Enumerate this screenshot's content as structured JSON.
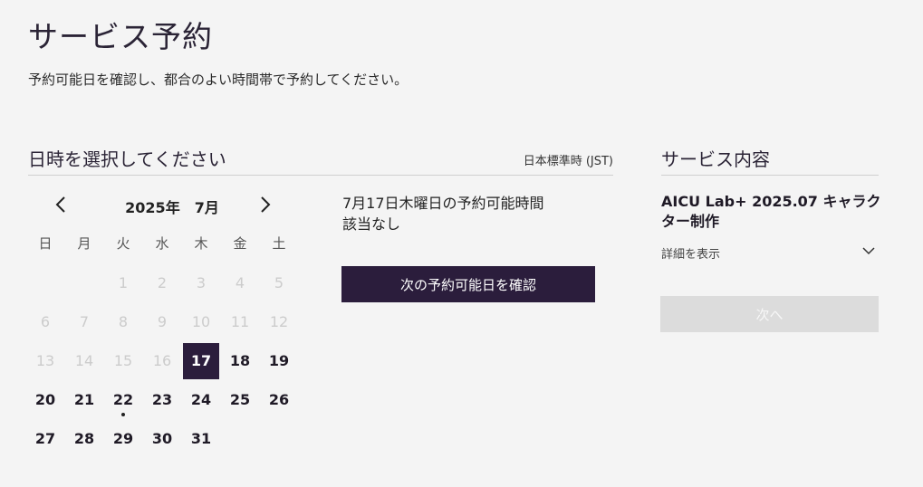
{
  "header": {
    "title": "サービス予約",
    "subtitle": "予約可能日を確認し、都合のよい時間帯で予約してください。"
  },
  "datetime": {
    "heading": "日時を選択してください",
    "timezone": "日本標準時 (JST)"
  },
  "calendar": {
    "month_label": "2025年　7月",
    "weekdays": [
      "日",
      "月",
      "火",
      "水",
      "木",
      "金",
      "土"
    ],
    "days": [
      {
        "label": "1",
        "state": "disabled"
      },
      {
        "label": "2",
        "state": "disabled"
      },
      {
        "label": "3",
        "state": "disabled"
      },
      {
        "label": "4",
        "state": "disabled"
      },
      {
        "label": "5",
        "state": "disabled"
      },
      {
        "label": "6",
        "state": "disabled"
      },
      {
        "label": "7",
        "state": "disabled"
      },
      {
        "label": "8",
        "state": "disabled"
      },
      {
        "label": "9",
        "state": "disabled"
      },
      {
        "label": "10",
        "state": "disabled"
      },
      {
        "label": "11",
        "state": "disabled"
      },
      {
        "label": "12",
        "state": "disabled"
      },
      {
        "label": "13",
        "state": "disabled"
      },
      {
        "label": "14",
        "state": "disabled"
      },
      {
        "label": "15",
        "state": "disabled"
      },
      {
        "label": "16",
        "state": "disabled"
      },
      {
        "label": "17",
        "state": "selected"
      },
      {
        "label": "18",
        "state": "enabled"
      },
      {
        "label": "19",
        "state": "enabled"
      },
      {
        "label": "20",
        "state": "enabled"
      },
      {
        "label": "21",
        "state": "enabled"
      },
      {
        "label": "22",
        "state": "today"
      },
      {
        "label": "23",
        "state": "enabled"
      },
      {
        "label": "24",
        "state": "enabled"
      },
      {
        "label": "25",
        "state": "enabled"
      },
      {
        "label": "26",
        "state": "enabled"
      },
      {
        "label": "27",
        "state": "enabled"
      },
      {
        "label": "28",
        "state": "enabled"
      },
      {
        "label": "29",
        "state": "enabled"
      },
      {
        "label": "30",
        "state": "enabled"
      },
      {
        "label": "31",
        "state": "enabled"
      }
    ]
  },
  "availability": {
    "title_line1": "7月17日木曜日の予約可能時間",
    "title_line2": "該当なし",
    "next_button": "次の予約可能日を確認"
  },
  "service": {
    "heading": "サービス内容",
    "name": "AICU Lab+ 2025.07 キャラクター制作",
    "detail_toggle": "詳細を表示",
    "next_button": "次へ"
  },
  "colors": {
    "accent": "#2b1d3c",
    "background": "#f4f4f4",
    "disabled_text": "#cccccc",
    "disabled_button": "#dcdcdc"
  },
  "icons": {
    "prev": "chevron-left-icon",
    "next": "chevron-right-icon",
    "expand": "chevron-down-icon"
  }
}
